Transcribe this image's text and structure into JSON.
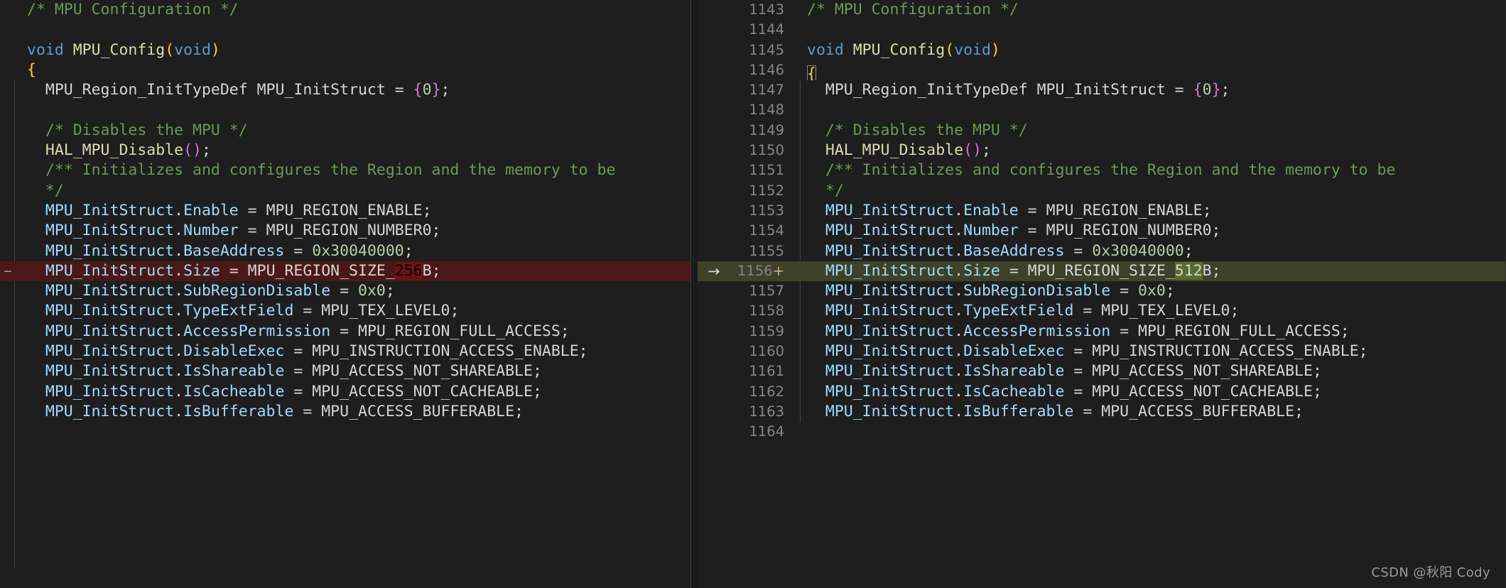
{
  "editor": {
    "kind": "side-by-side-diff",
    "theme": "dark-plus",
    "background": "#1e1e1e",
    "removed_line_bg": "#4b1818",
    "added_line_bg": "#3d4228",
    "char_removed_bg": "#6f1313",
    "char_added_bg": "#5b6b2e"
  },
  "original": {
    "marker_removed": "−",
    "lines": [
      {
        "id": "o1",
        "marker": "",
        "segs": [
          {
            "t": "/* MPU Configuration */",
            "c": "cmt"
          }
        ]
      },
      {
        "id": "o2",
        "marker": "",
        "segs": []
      },
      {
        "id": "o3",
        "marker": "",
        "segs": [
          {
            "t": "void",
            "c": "kw"
          },
          {
            "t": " ",
            "c": "punc"
          },
          {
            "t": "MPU_Config",
            "c": "fn"
          },
          {
            "t": "(",
            "c": "brace-y"
          },
          {
            "t": "void",
            "c": "kw"
          },
          {
            "t": ")",
            "c": "brace-y"
          }
        ]
      },
      {
        "id": "o4",
        "marker": "",
        "segs": [
          {
            "t": "{",
            "c": "brace-y"
          }
        ]
      },
      {
        "id": "o5",
        "marker": "",
        "segs": [
          {
            "t": "  MPU_Region_InitTypeDef MPU_InitStruct = ",
            "c": "id"
          },
          {
            "t": "{",
            "c": "brace-p"
          },
          {
            "t": "0",
            "c": "num"
          },
          {
            "t": "}",
            "c": "brace-p"
          },
          {
            "t": ";",
            "c": "punc"
          }
        ]
      },
      {
        "id": "o6",
        "marker": "",
        "segs": []
      },
      {
        "id": "o7",
        "marker": "",
        "segs": [
          {
            "t": "  /* Disables the MPU */",
            "c": "cmt"
          }
        ]
      },
      {
        "id": "o8",
        "marker": "",
        "segs": [
          {
            "t": "  ",
            "c": "punc"
          },
          {
            "t": "HAL_MPU_Disable",
            "c": "fn"
          },
          {
            "t": "(",
            "c": "brace-p"
          },
          {
            "t": ")",
            "c": "brace-p"
          },
          {
            "t": ";",
            "c": "punc"
          }
        ]
      },
      {
        "id": "o9",
        "marker": "",
        "segs": [
          {
            "t": "  /** Initializes and configures the Region and the memory to be",
            "c": "cmt"
          }
        ]
      },
      {
        "id": "o10",
        "marker": "",
        "segs": [
          {
            "t": "  */",
            "c": "cmt"
          }
        ]
      },
      {
        "id": "o11",
        "marker": "",
        "segs": [
          {
            "t": "  ",
            "c": "punc"
          },
          {
            "t": "MPU_InitStruct",
            "c": "var"
          },
          {
            "t": ".",
            "c": "punc"
          },
          {
            "t": "Enable",
            "c": "var"
          },
          {
            "t": " = MPU_REGION_ENABLE;",
            "c": "id"
          }
        ]
      },
      {
        "id": "o12",
        "marker": "",
        "segs": [
          {
            "t": "  ",
            "c": "punc"
          },
          {
            "t": "MPU_InitStruct",
            "c": "var"
          },
          {
            "t": ".",
            "c": "punc"
          },
          {
            "t": "Number",
            "c": "var"
          },
          {
            "t": " = MPU_REGION_NUMBER0;",
            "c": "id"
          }
        ]
      },
      {
        "id": "o13",
        "marker": "",
        "segs": [
          {
            "t": "  ",
            "c": "punc"
          },
          {
            "t": "MPU_InitStruct",
            "c": "var"
          },
          {
            "t": ".",
            "c": "punc"
          },
          {
            "t": "BaseAddress",
            "c": "var"
          },
          {
            "t": " = ",
            "c": "id"
          },
          {
            "t": "0x30040000",
            "c": "num"
          },
          {
            "t": ";",
            "c": "punc"
          }
        ]
      },
      {
        "id": "o14",
        "marker": "−",
        "diff": "removed",
        "segs": [
          {
            "t": "  ",
            "c": "punc"
          },
          {
            "t": "MPU_InitStruct",
            "c": "var"
          },
          {
            "t": ".",
            "c": "punc"
          },
          {
            "t": "Size",
            "c": "var"
          },
          {
            "t": " = MPU_REGION_SIZE_",
            "c": "id"
          },
          {
            "t": "256",
            "c": "char-del"
          },
          {
            "t": "B;",
            "c": "id"
          }
        ]
      },
      {
        "id": "o15",
        "marker": "",
        "segs": [
          {
            "t": "  ",
            "c": "punc"
          },
          {
            "t": "MPU_InitStruct",
            "c": "var"
          },
          {
            "t": ".",
            "c": "punc"
          },
          {
            "t": "SubRegionDisable",
            "c": "var"
          },
          {
            "t": " = ",
            "c": "id"
          },
          {
            "t": "0x0",
            "c": "num"
          },
          {
            "t": ";",
            "c": "punc"
          }
        ]
      },
      {
        "id": "o16",
        "marker": "",
        "segs": [
          {
            "t": "  ",
            "c": "punc"
          },
          {
            "t": "MPU_InitStruct",
            "c": "var"
          },
          {
            "t": ".",
            "c": "punc"
          },
          {
            "t": "TypeExtField",
            "c": "var"
          },
          {
            "t": " = MPU_TEX_LEVEL0;",
            "c": "id"
          }
        ]
      },
      {
        "id": "o17",
        "marker": "",
        "segs": [
          {
            "t": "  ",
            "c": "punc"
          },
          {
            "t": "MPU_InitStruct",
            "c": "var"
          },
          {
            "t": ".",
            "c": "punc"
          },
          {
            "t": "AccessPermission",
            "c": "var"
          },
          {
            "t": " = MPU_REGION_FULL_ACCESS;",
            "c": "id"
          }
        ]
      },
      {
        "id": "o18",
        "marker": "",
        "segs": [
          {
            "t": "  ",
            "c": "punc"
          },
          {
            "t": "MPU_InitStruct",
            "c": "var"
          },
          {
            "t": ".",
            "c": "punc"
          },
          {
            "t": "DisableExec",
            "c": "var"
          },
          {
            "t": " = MPU_INSTRUCTION_ACCESS_ENABLE;",
            "c": "id"
          }
        ]
      },
      {
        "id": "o19",
        "marker": "",
        "segs": [
          {
            "t": "  ",
            "c": "punc"
          },
          {
            "t": "MPU_InitStruct",
            "c": "var"
          },
          {
            "t": ".",
            "c": "punc"
          },
          {
            "t": "IsShareable",
            "c": "var"
          },
          {
            "t": " = MPU_ACCESS_NOT_SHAREABLE;",
            "c": "id"
          }
        ]
      },
      {
        "id": "o20",
        "marker": "",
        "segs": [
          {
            "t": "  ",
            "c": "punc"
          },
          {
            "t": "MPU_InitStruct",
            "c": "var"
          },
          {
            "t": ".",
            "c": "punc"
          },
          {
            "t": "IsCacheable",
            "c": "var"
          },
          {
            "t": " = MPU_ACCESS_NOT_CACHEABLE;",
            "c": "id"
          }
        ]
      },
      {
        "id": "o21",
        "marker": "",
        "segs": [
          {
            "t": "  ",
            "c": "punc"
          },
          {
            "t": "MPU_InitStruct",
            "c": "var"
          },
          {
            "t": ".",
            "c": "punc"
          },
          {
            "t": "IsBufferable",
            "c": "var"
          },
          {
            "t": " = MPU_ACCESS_BUFFERABLE;",
            "c": "id"
          }
        ]
      },
      {
        "id": "o22",
        "marker": "",
        "segs": []
      }
    ]
  },
  "modified": {
    "arrow_glyph": "→",
    "plus_glyph": "+",
    "lines": [
      {
        "id": "m1",
        "num": "1143",
        "segs": [
          {
            "t": "/* MPU Configuration */",
            "c": "cmt"
          }
        ]
      },
      {
        "id": "m2",
        "num": "1144",
        "segs": []
      },
      {
        "id": "m3",
        "num": "1145",
        "segs": [
          {
            "t": "void",
            "c": "kw"
          },
          {
            "t": " ",
            "c": "punc"
          },
          {
            "t": "MPU_Config",
            "c": "fn"
          },
          {
            "t": "(",
            "c": "brace-y"
          },
          {
            "t": "void",
            "c": "kw"
          },
          {
            "t": ")",
            "c": "brace-y"
          }
        ]
      },
      {
        "id": "m4",
        "num": "1146",
        "bracket_match": true,
        "segs": [
          {
            "t": "{",
            "c": "brace-y"
          }
        ]
      },
      {
        "id": "m5",
        "num": "1147",
        "segs": [
          {
            "t": "  MPU_Region_InitTypeDef MPU_InitStruct = ",
            "c": "id"
          },
          {
            "t": "{",
            "c": "brace-p"
          },
          {
            "t": "0",
            "c": "num"
          },
          {
            "t": "}",
            "c": "brace-p"
          },
          {
            "t": ";",
            "c": "punc"
          }
        ]
      },
      {
        "id": "m6",
        "num": "1148",
        "segs": []
      },
      {
        "id": "m7",
        "num": "1149",
        "segs": [
          {
            "t": "  /* Disables the MPU */",
            "c": "cmt"
          }
        ]
      },
      {
        "id": "m8",
        "num": "1150",
        "segs": [
          {
            "t": "  ",
            "c": "punc"
          },
          {
            "t": "HAL_MPU_Disable",
            "c": "fn"
          },
          {
            "t": "(",
            "c": "brace-p"
          },
          {
            "t": ")",
            "c": "brace-p"
          },
          {
            "t": ";",
            "c": "punc"
          }
        ]
      },
      {
        "id": "m9",
        "num": "1151",
        "segs": [
          {
            "t": "  /** Initializes and configures the Region and the memory to be",
            "c": "cmt"
          }
        ]
      },
      {
        "id": "m10",
        "num": "1152",
        "segs": [
          {
            "t": "  */",
            "c": "cmt"
          }
        ]
      },
      {
        "id": "m11",
        "num": "1153",
        "segs": [
          {
            "t": "  ",
            "c": "punc"
          },
          {
            "t": "MPU_InitStruct",
            "c": "var"
          },
          {
            "t": ".",
            "c": "punc"
          },
          {
            "t": "Enable",
            "c": "var"
          },
          {
            "t": " = MPU_REGION_ENABLE;",
            "c": "id"
          }
        ]
      },
      {
        "id": "m12",
        "num": "1154",
        "segs": [
          {
            "t": "  ",
            "c": "punc"
          },
          {
            "t": "MPU_InitStruct",
            "c": "var"
          },
          {
            "t": ".",
            "c": "punc"
          },
          {
            "t": "Number",
            "c": "var"
          },
          {
            "t": " = MPU_REGION_NUMBER0;",
            "c": "id"
          }
        ]
      },
      {
        "id": "m13",
        "num": "1155",
        "segs": [
          {
            "t": "  ",
            "c": "punc"
          },
          {
            "t": "MPU_InitStruct",
            "c": "var"
          },
          {
            "t": ".",
            "c": "punc"
          },
          {
            "t": "BaseAddress",
            "c": "var"
          },
          {
            "t": " = ",
            "c": "id"
          },
          {
            "t": "0x30040000",
            "c": "num"
          },
          {
            "t": ";",
            "c": "punc"
          }
        ]
      },
      {
        "id": "m14",
        "num": "1156",
        "diff": "added",
        "arrow": true,
        "plus": true,
        "segs": [
          {
            "t": "  ",
            "c": "punc"
          },
          {
            "t": "MPU_InitStruct",
            "c": "var"
          },
          {
            "t": ".",
            "c": "punc"
          },
          {
            "t": "Size",
            "c": "var"
          },
          {
            "t": " = MPU_REGION_SIZE_",
            "c": "id"
          },
          {
            "t": "512",
            "c": "char-ins"
          },
          {
            "t": "B;",
            "c": "id"
          }
        ]
      },
      {
        "id": "m15",
        "num": "1157",
        "segs": [
          {
            "t": "  ",
            "c": "punc"
          },
          {
            "t": "MPU_InitStruct",
            "c": "var"
          },
          {
            "t": ".",
            "c": "punc"
          },
          {
            "t": "SubRegionDisable",
            "c": "var"
          },
          {
            "t": " = ",
            "c": "id"
          },
          {
            "t": "0x0",
            "c": "num"
          },
          {
            "t": ";",
            "c": "punc"
          }
        ]
      },
      {
        "id": "m16",
        "num": "1158",
        "segs": [
          {
            "t": "  ",
            "c": "punc"
          },
          {
            "t": "MPU_InitStruct",
            "c": "var"
          },
          {
            "t": ".",
            "c": "punc"
          },
          {
            "t": "TypeExtField",
            "c": "var"
          },
          {
            "t": " = MPU_TEX_LEVEL0;",
            "c": "id"
          }
        ]
      },
      {
        "id": "m17",
        "num": "1159",
        "segs": [
          {
            "t": "  ",
            "c": "punc"
          },
          {
            "t": "MPU_InitStruct",
            "c": "var"
          },
          {
            "t": ".",
            "c": "punc"
          },
          {
            "t": "AccessPermission",
            "c": "var"
          },
          {
            "t": " = MPU_REGION_FULL_ACCESS;",
            "c": "id"
          }
        ]
      },
      {
        "id": "m18",
        "num": "1160",
        "segs": [
          {
            "t": "  ",
            "c": "punc"
          },
          {
            "t": "MPU_InitStruct",
            "c": "var"
          },
          {
            "t": ".",
            "c": "punc"
          },
          {
            "t": "DisableExec",
            "c": "var"
          },
          {
            "t": " = MPU_INSTRUCTION_ACCESS_ENABLE;",
            "c": "id"
          }
        ]
      },
      {
        "id": "m19",
        "num": "1161",
        "segs": [
          {
            "t": "  ",
            "c": "punc"
          },
          {
            "t": "MPU_InitStruct",
            "c": "var"
          },
          {
            "t": ".",
            "c": "punc"
          },
          {
            "t": "IsShareable",
            "c": "var"
          },
          {
            "t": " = MPU_ACCESS_NOT_SHAREABLE;",
            "c": "id"
          }
        ]
      },
      {
        "id": "m20",
        "num": "1162",
        "segs": [
          {
            "t": "  ",
            "c": "punc"
          },
          {
            "t": "MPU_InitStruct",
            "c": "var"
          },
          {
            "t": ".",
            "c": "punc"
          },
          {
            "t": "IsCacheable",
            "c": "var"
          },
          {
            "t": " = MPU_ACCESS_NOT_CACHEABLE;",
            "c": "id"
          }
        ]
      },
      {
        "id": "m21",
        "num": "1163",
        "segs": [
          {
            "t": "  ",
            "c": "punc"
          },
          {
            "t": "MPU_InitStruct",
            "c": "var"
          },
          {
            "t": ".",
            "c": "punc"
          },
          {
            "t": "IsBufferable",
            "c": "var"
          },
          {
            "t": " = MPU_ACCESS_BUFFERABLE;",
            "c": "id"
          }
        ]
      },
      {
        "id": "m22",
        "num": "1164",
        "segs": []
      }
    ]
  },
  "watermark": {
    "text": "CSDN @秋阳 Cody"
  }
}
